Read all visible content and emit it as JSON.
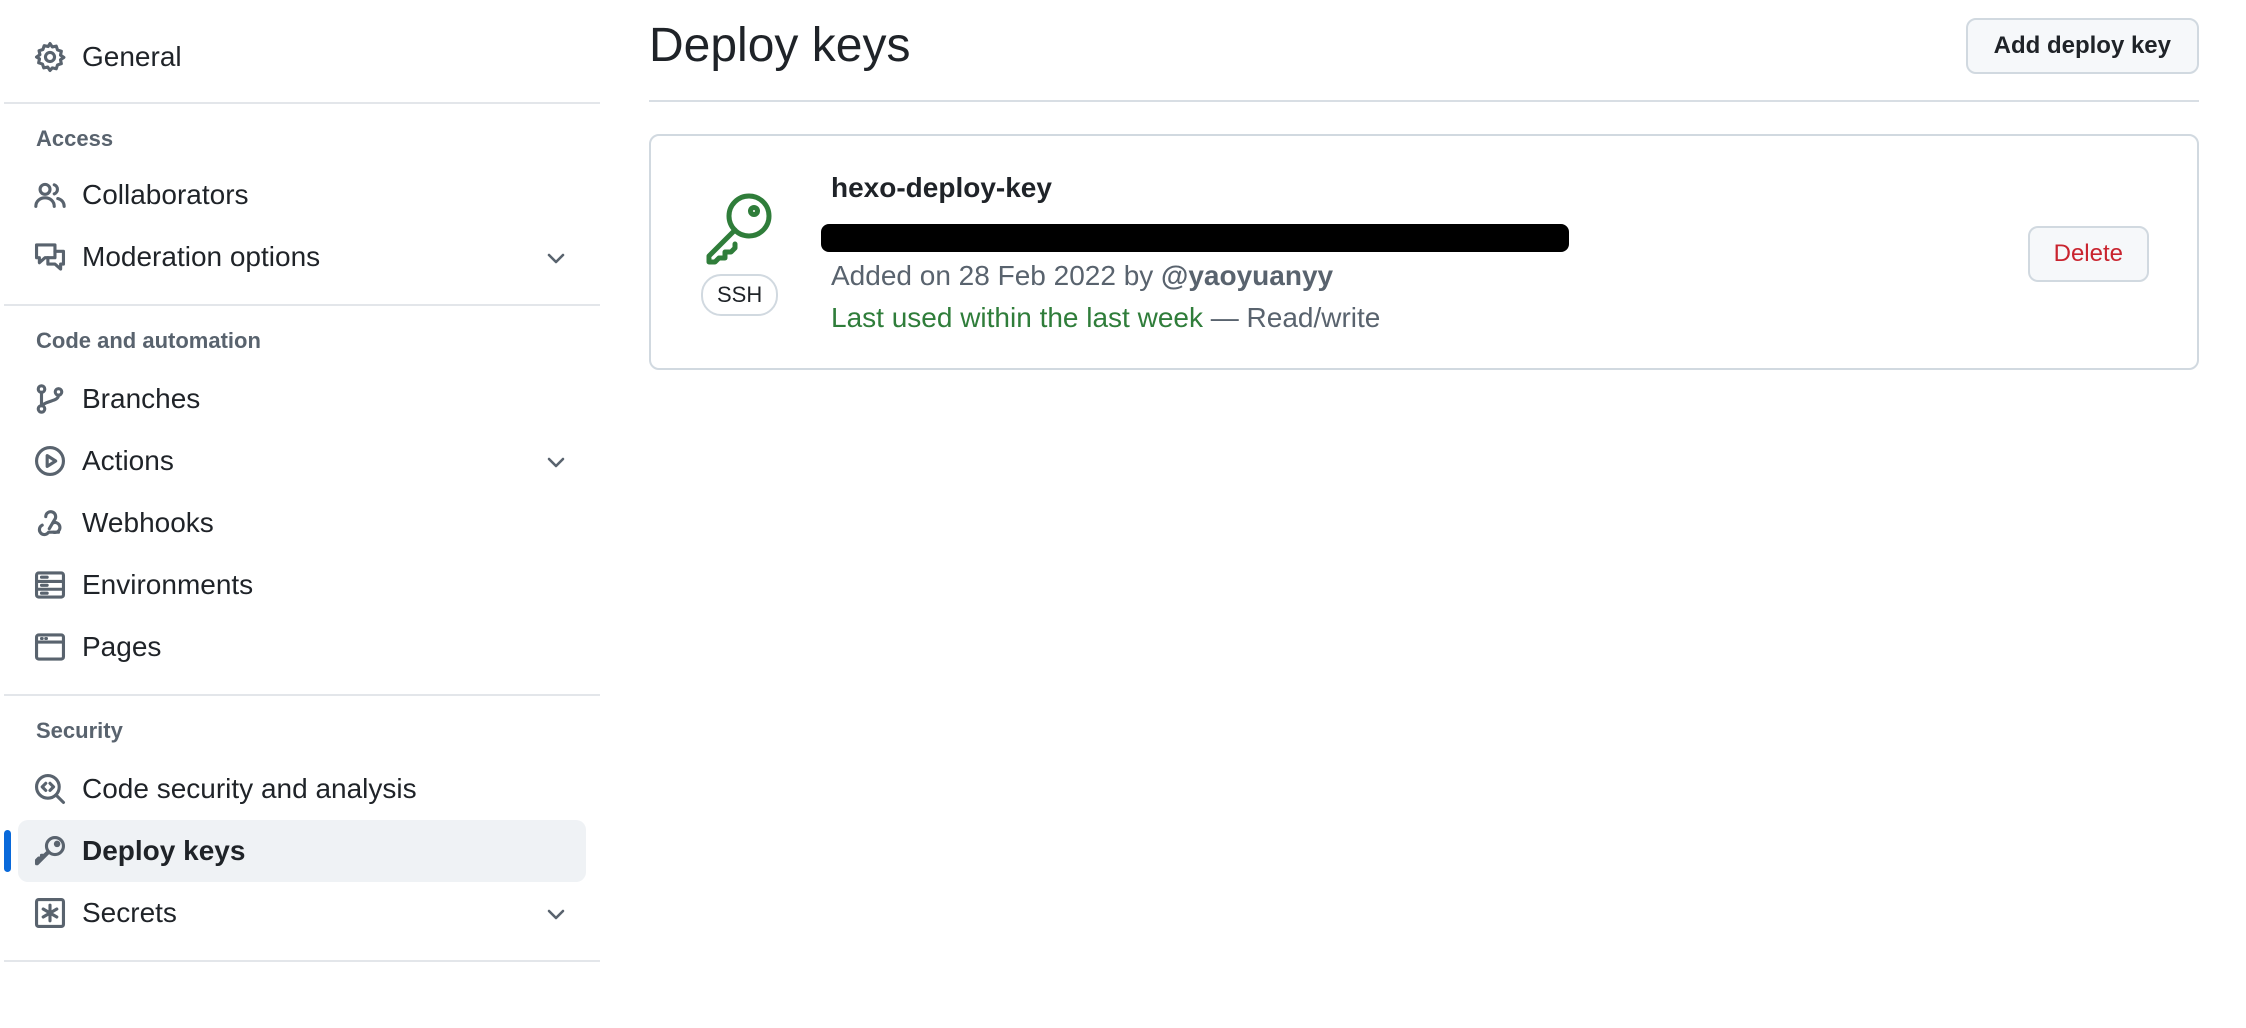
{
  "sidebar": {
    "general_label": "General",
    "access_heading": "Access",
    "collaborators_label": "Collaborators",
    "moderation_label": "Moderation options",
    "code_heading": "Code and automation",
    "branches_label": "Branches",
    "actions_label": "Actions",
    "webhooks_label": "Webhooks",
    "environments_label": "Environments",
    "pages_label": "Pages",
    "security_heading": "Security",
    "code_security_label": "Code security and analysis",
    "deploy_keys_label": "Deploy keys",
    "secrets_label": "Secrets"
  },
  "main": {
    "title": "Deploy keys",
    "add_button_label": "Add deploy key",
    "key": {
      "name": "hexo-deploy-key",
      "type_badge": "SSH",
      "added_prefix": "Added on 28 Feb 2022 by ",
      "added_user": "@yaoyuanyy",
      "last_used": "Last used within the last week",
      "access": " — Read/write",
      "delete_label": "Delete"
    }
  },
  "colors": {
    "accent": "#0969da",
    "success": "#2f7d3a",
    "danger": "#c9242f"
  }
}
